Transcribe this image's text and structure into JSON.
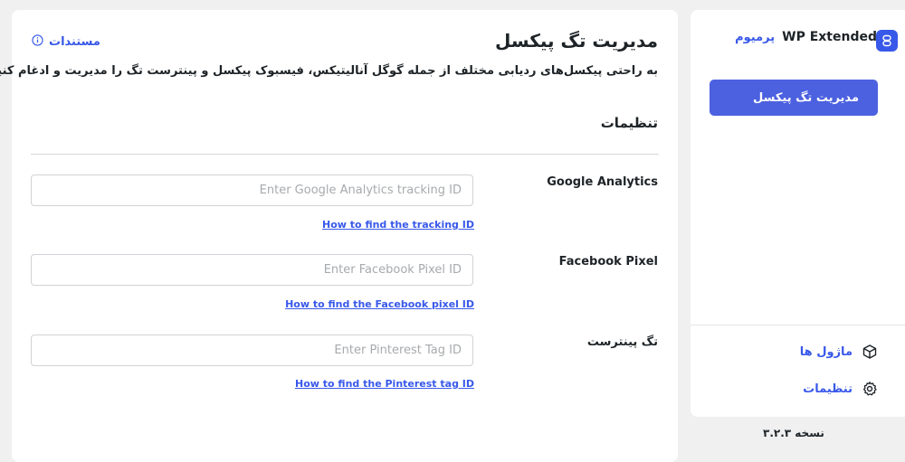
{
  "header": {
    "title": "مدیریت تگ پیکسل",
    "docs_label": "مستندات",
    "description": "به راحتی پیکسل‌های ردیابی مختلف از جمله گوگل آنالیتیکس، فیسبوک پیکسل و پینترست تگ را مدیریت و ادغام کنید"
  },
  "settings": {
    "section_title": "تنظیمات",
    "fields": [
      {
        "label": "Google Analytics",
        "value": "",
        "placeholder": "Enter Google Analytics tracking ID",
        "help": "How to find the tracking ID"
      },
      {
        "label": "Facebook Pixel",
        "value": "",
        "placeholder": "Enter Facebook Pixel ID",
        "help": "How to find the Facebook pixel ID"
      },
      {
        "label": "تگ پینترست",
        "value": "",
        "placeholder": "Enter Pinterest Tag ID",
        "help": "How to find the Pinterest tag ID"
      }
    ]
  },
  "sidebar": {
    "brand_name": "WP Extended",
    "brand_badge": "پرمیوم",
    "active_item": "مدیریت تگ پیکسل",
    "items": [
      {
        "label": "ماژول ها",
        "icon": "cube-icon"
      },
      {
        "label": "تنظیمات",
        "icon": "gear-icon"
      }
    ],
    "version": "نسخه ۳.۲.۳"
  },
  "colors": {
    "accent": "#3858e9",
    "active_nav": "#4c61e0",
    "background": "#f0f0f1"
  }
}
